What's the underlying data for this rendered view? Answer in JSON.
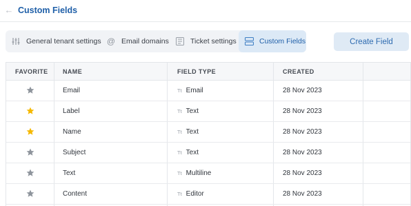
{
  "header": {
    "title": "Custom Fields",
    "back_icon": "arrow-left-icon"
  },
  "tabs": [
    {
      "label": "General tenant settings",
      "icon": "sliders-icon",
      "active": false
    },
    {
      "label": "Email domains",
      "icon": "at-sign-icon",
      "active": false
    },
    {
      "label": "Ticket settings",
      "icon": "ticket-settings-icon",
      "active": false
    },
    {
      "label": "Custom Fields",
      "icon": "stack-icon",
      "active": true
    }
  ],
  "create_button": {
    "label": "Create Field"
  },
  "table": {
    "columns": [
      "FAVORITE",
      "NAME",
      "FIELD TYPE",
      "CREATED"
    ],
    "type_glyph": "Tt",
    "rows": [
      {
        "favorite": false,
        "name": "Email",
        "field_type": "Email",
        "created": "28 Nov 2023"
      },
      {
        "favorite": true,
        "name": "Label",
        "field_type": "Text",
        "created": "28 Nov 2023"
      },
      {
        "favorite": true,
        "name": "Name",
        "field_type": "Text",
        "created": "28 Nov 2023"
      },
      {
        "favorite": false,
        "name": "Subject",
        "field_type": "Text",
        "created": "28 Nov 2023"
      },
      {
        "favorite": false,
        "name": "Text",
        "field_type": "Multiline",
        "created": "28 Nov 2023"
      },
      {
        "favorite": false,
        "name": "Content",
        "field_type": "Editor",
        "created": "28 Nov 2023"
      }
    ]
  },
  "colors": {
    "accent": "#1f5fa8",
    "star_active": "#f5b800",
    "star_inactive": "#8e949c",
    "tab_active_bg": "#dce9f6"
  }
}
